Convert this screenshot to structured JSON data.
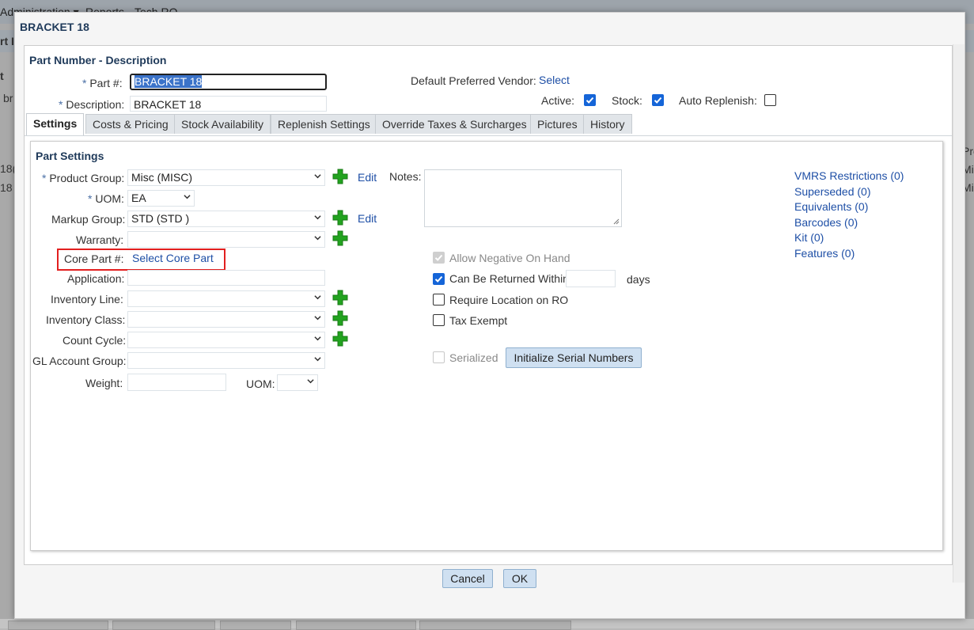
{
  "background": {
    "nav": [
      "Administration ▾",
      "Reports",
      "Tech RO"
    ],
    "left_fragments": [
      "rt I",
      "t",
      "br",
      "18(",
      "18"
    ],
    "right_fragments": [
      "Pro",
      "Mi:",
      "Mi:"
    ]
  },
  "dialog": {
    "title": "BRACKET 18",
    "section_title": "Part Number - Description",
    "part_number_label": "Part #:",
    "part_number_value": "BRACKET 18",
    "description_label": "Description:",
    "description_value": "BRACKET 18",
    "required_mark": "*",
    "vendor_label": "Default Preferred Vendor:",
    "vendor_link": "Select",
    "active_label": "Active:",
    "active_checked": true,
    "stock_label": "Stock:",
    "stock_checked": true,
    "auto_replenish_label": "Auto Replenish:",
    "auto_replenish_checked": false,
    "tabs": [
      "Settings",
      "Costs & Pricing",
      "Stock Availability",
      "Replenish Settings",
      "Override Taxes & Surcharges",
      "Pictures",
      "History"
    ],
    "active_tab": "Settings",
    "panel": {
      "title": "Part Settings",
      "product_group_label": "Product Group:",
      "product_group_value": "Misc (MISC)",
      "uom_label": "UOM:",
      "uom_value": "EA",
      "markup_group_label": "Markup Group:",
      "markup_group_value": "STD (STD )",
      "warranty_label": "Warranty:",
      "warranty_value": "",
      "core_part_label": "Core Part #:",
      "core_part_link": "Select Core Part",
      "application_label": "Application:",
      "application_value": "",
      "inventory_line_label": "Inventory Line:",
      "inventory_class_label": "Inventory Class:",
      "count_cycle_label": "Count Cycle:",
      "gl_account_group_label": "GL Account Group:",
      "weight_label": "Weight:",
      "weight_value": "",
      "weight_uom_label": "UOM:",
      "edit_label": "Edit",
      "notes_label": "Notes:",
      "notes_value": "",
      "allow_negative_label": "Allow Negative On Hand",
      "allow_negative_checked": true,
      "can_be_returned_label": "Can Be Returned Within",
      "can_be_returned_checked": true,
      "return_days_value": "",
      "days_label": "days",
      "require_location_label": "Require Location on RO",
      "require_location_checked": false,
      "tax_exempt_label": "Tax Exempt",
      "tax_exempt_checked": false,
      "serialized_label": "Serialized",
      "serialized_checked": false,
      "init_serial_button": "Initialize Serial Numbers",
      "right_links": [
        "VMRS Restrictions (0)",
        "Superseded (0)",
        "Equivalents (0)",
        "Barcodes (0)",
        "Kit (0)",
        "Features (0)"
      ]
    },
    "cancel_button": "Cancel",
    "ok_button": "OK"
  },
  "colors": {
    "link": "#1e4fa6",
    "title": "#1f3a5a",
    "plus_icon": "#22a31f",
    "highlight_box": "#e21f1f",
    "button_bg": "#cfe0f1",
    "checkbox_on": "#1565d8"
  },
  "icons": [
    "plus-icon",
    "chevron-down-icon",
    "checkmark-icon",
    "resize-grip-icon"
  ]
}
